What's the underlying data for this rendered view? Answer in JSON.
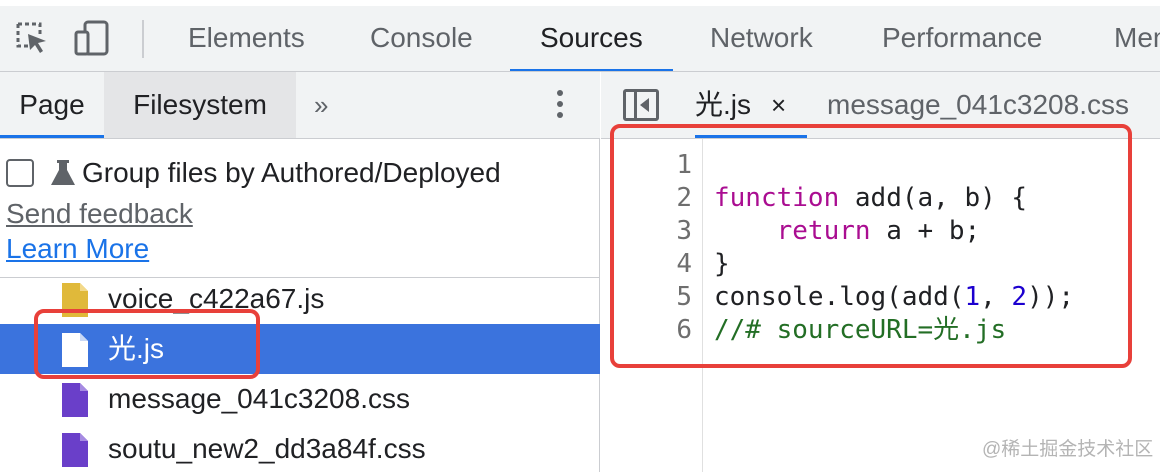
{
  "toolbar": {
    "tabs": [
      "Elements",
      "Console",
      "Sources",
      "Network",
      "Performance",
      "Memory"
    ],
    "active_tab": "Sources"
  },
  "navigator": {
    "tabs": [
      "Page",
      "Filesystem"
    ],
    "active_tab": "Page",
    "more_tabs_glyph": "»",
    "group_files_label": "Group files by Authored/Deployed",
    "send_feedback": "Send feedback",
    "learn_more": "Learn More",
    "files": [
      {
        "name": "voice_c422a67.js",
        "type": "js",
        "selected": false
      },
      {
        "name": "光.js",
        "type": "js",
        "selected": true
      },
      {
        "name": "message_041c3208.css",
        "type": "css",
        "selected": false
      },
      {
        "name": "soutu_new2_dd3a84f.css",
        "type": "css",
        "selected": false
      }
    ]
  },
  "editor": {
    "open_tabs": [
      {
        "name": "光.js",
        "active": true,
        "closable": true
      },
      {
        "name": "message_041c3208.css",
        "active": false
      }
    ],
    "close_glyph": "×",
    "line_numbers": [
      "1",
      "2",
      "3",
      "4",
      "5",
      "6"
    ],
    "code": {
      "l2_kw": "function",
      "l2_rest": " add(a, b) {",
      "l3_indent": "    ",
      "l3_kw": "return",
      "l3_rest": " a + b;",
      "l4": "}",
      "l5_a": "console.log(add(",
      "l5_n1": "1",
      "l5_b": ", ",
      "l5_n2": "2",
      "l5_c": "));",
      "l6": "//# sourceURL=光.js"
    }
  },
  "colors": {
    "accent": "#1a73e8",
    "selection": "#3b73dd",
    "highlight_box": "#e8403a",
    "keyword": "#aa0d91",
    "number": "#1c00cf",
    "comment": "#236e25",
    "js_icon": "#e0b93a",
    "css_icon": "#6a3fc9"
  },
  "icons": [
    "inspect-element-icon",
    "device-toolbar-icon",
    "flask-icon",
    "kebab-menu-icon",
    "toggle-navigator-icon",
    "file-icon"
  ],
  "watermark": "@稀土掘金技术社区"
}
